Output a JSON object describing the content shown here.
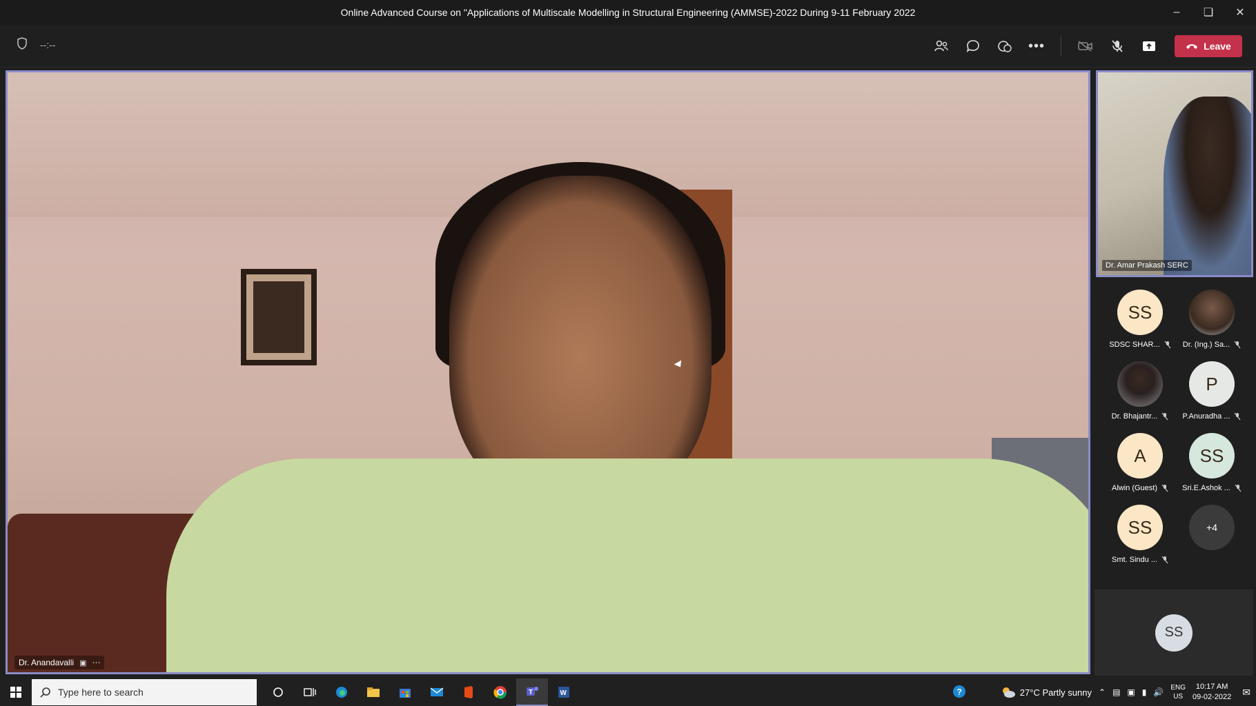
{
  "window": {
    "title": "Online Advanced Course on \"Applications of Multiscale Modelling in Structural Engineering (AMMSE)-2022 During 9-11 February 2022",
    "controls": [
      "minimize",
      "restore",
      "close"
    ]
  },
  "toolbar": {
    "left_timer": "--:--",
    "leave_label": "Leave",
    "icons": [
      "people-icon",
      "chat-icon",
      "reactions-icon",
      "more-icon",
      "camera-off-icon",
      "mic-off-icon",
      "share-icon"
    ]
  },
  "main_video": {
    "speaker_name": "Dr. Anandavalli"
  },
  "self_video": {
    "name": "Dr. Amar Prakash SERC"
  },
  "participants": [
    {
      "initials": "SS",
      "label": "SDSC SHAR...",
      "color": "#fbe7c6",
      "photo": false
    },
    {
      "initials": "",
      "label": "Dr. (Ing.) Sa...",
      "color": "#c9ccd4",
      "photo": true
    },
    {
      "initials": "",
      "label": "Dr. Bhajantr...",
      "color": "#8a8a8a",
      "photo": true
    },
    {
      "initials": "P",
      "label": "P.Anuradha ...",
      "color": "#e6e8e6",
      "photo": false
    },
    {
      "initials": "A",
      "label": "Alwin (Guest)",
      "color": "#fbe7c6",
      "photo": false
    },
    {
      "initials": "SS",
      "label": "Sri.E.Ashok ...",
      "color": "#d6e7dd",
      "photo": false
    },
    {
      "initials": "SS",
      "label": "Smt. Sindu ...",
      "color": "#fbe7c6",
      "photo": false
    },
    {
      "initials": "+4",
      "label": "",
      "color": "#3b3b3b",
      "photo": false
    }
  ],
  "bottom_participant": {
    "initials": "SS"
  },
  "taskbar": {
    "search_placeholder": "Type here to search",
    "weather": "27°C  Partly sunny",
    "lang_top": "ENG",
    "lang_bottom": "US",
    "time": "10:17 AM",
    "date": "09-02-2022"
  }
}
